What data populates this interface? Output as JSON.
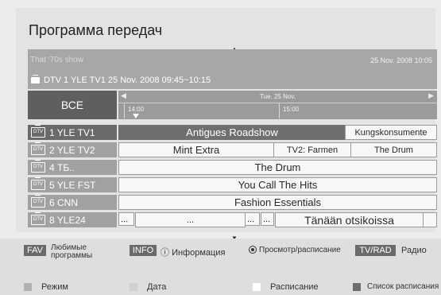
{
  "header": {
    "title": "Программа передач"
  },
  "info": {
    "show": "That '70s show",
    "datetime": "25 Nov. 2008 10:05",
    "channel_line": "DTV  1 YLE TV1 25 Nov. 2008 09:45~10:15"
  },
  "all_button": "ВСЕ",
  "timeline": {
    "date": "Tue. 25 Nov.",
    "times": [
      "14:00",
      "15:00"
    ],
    "left_arrow": "◀",
    "right_arrow": "▶"
  },
  "channels": [
    {
      "badge": "DTV",
      "name": "1  YLE TV1",
      "selected": true,
      "programs": [
        "Antigues Roadshow",
        "Kungskonsumente"
      ]
    },
    {
      "badge": "DTV",
      "name": "2  YLE TV2",
      "programs": [
        "Mint Extra",
        "TV2: Farmen",
        "The Drum"
      ]
    },
    {
      "badge": "DTV",
      "name": "4  ТБ..",
      "programs": [
        "The Drum"
      ]
    },
    {
      "badge": "DTV",
      "name": "5  YLE FST",
      "programs": [
        "You Call The Hits"
      ]
    },
    {
      "badge": "DTV",
      "name": "6  CNN",
      "programs": [
        "Fashion Essentials"
      ]
    },
    {
      "badge": "DTV",
      "name": "8  YLE24",
      "programs": [
        "...",
        "...",
        "...",
        "...",
        "Tänään otsikoissa",
        ""
      ]
    }
  ],
  "legend": {
    "fav_key": "FAV",
    "fav_label_1": "Любимые",
    "fav_label_2": "программы",
    "info_key": "INFO",
    "info_icon": "ⓘ",
    "info_label": "Информация",
    "ok_label": "Просмотр/расписание",
    "tvrad_key": "TV/RAD",
    "tvrad_label": "Радио",
    "red_label": "Режим",
    "green_label": "Дата",
    "yellow_label": "Расписание",
    "blue_label": "Список расписания",
    "colors": {
      "red": "#b0b0b0",
      "green": "#cfcfcf",
      "yellow": "#ffffff",
      "blue": "#6e6e6e"
    }
  }
}
